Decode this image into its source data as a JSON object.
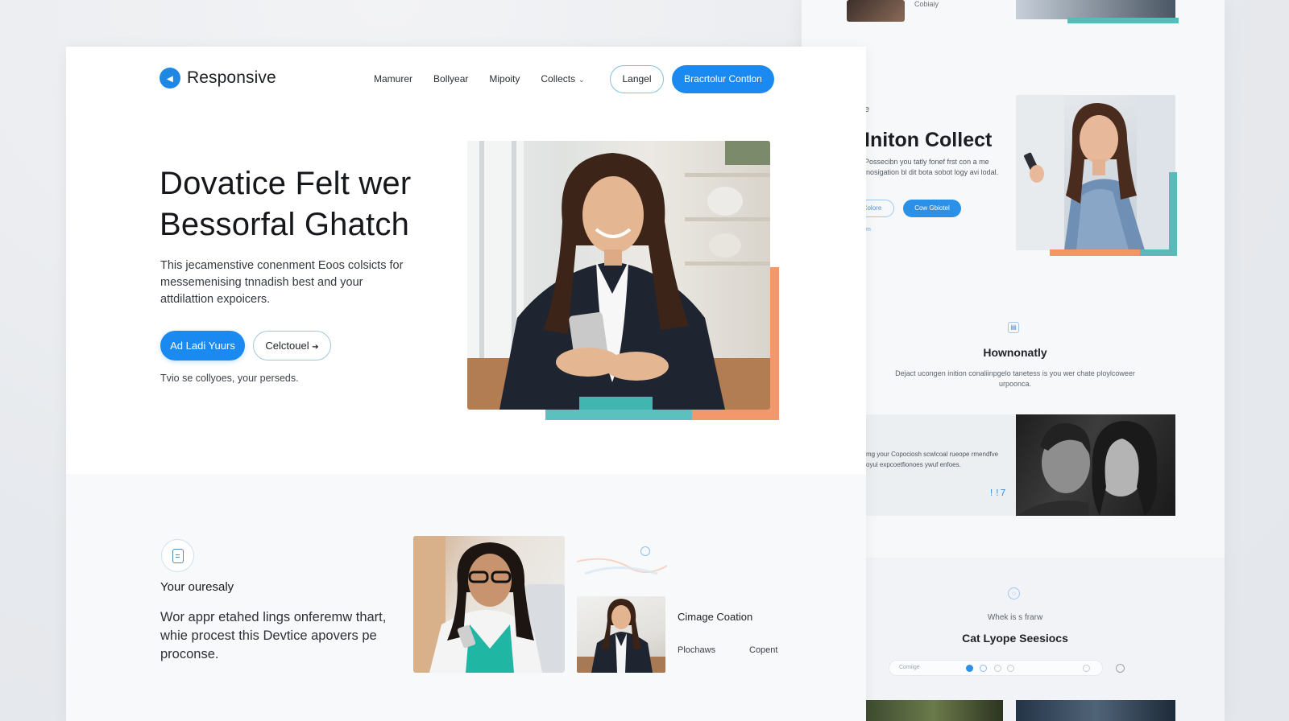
{
  "secondary_page": {
    "small_label_top": "Cobiaiy",
    "eyebrow": "e",
    "title": "Initon Collect",
    "description": "Possecibn you tatly fonef frst con a me inosigation bl dit bota sobot logy avi lodal.",
    "button_ghost": "Colore",
    "button_solid": "Cow Gbiotel",
    "tiny_link": "m",
    "feature_title": "Hownonatly",
    "feature_description": "Dejact ucongen inition conaliinpgelo tanetess is you wer chate ploylcoweer urpoonca.",
    "card_text": "mg your Copociosh scwlcoal rueope rmendfve oyui expcoetfionoes ywuf enfoes.",
    "card_number": "!!7",
    "panel_eyebrow": "Whek is s frarw",
    "panel_title": "Cat Lyope Seesiocs",
    "panel_bar_label": "Comiige"
  },
  "main_page": {
    "logo_text": "Responsive",
    "nav_links": [
      "Mamurer",
      "Bollyear",
      "Mipoity",
      "Collects"
    ],
    "nav_button_outline": "Langel",
    "nav_button_primary": "Bracrtolur Contlon",
    "hero": {
      "title": "Dovatice Felt wer Bessorfal Ghatch",
      "description": "This jecamenstive conenment Eoos colsicts for messemenising tnnadish best and your attdilattion expoicers.",
      "button_primary": "Ad Ladi Yuurs",
      "button_outline": "Celctouel",
      "note": "Tvio se collyoes, your perseds."
    },
    "section_two": {
      "heading": "Your ouresaly",
      "text": "Wor appr etahed lings onferemw thart, whie procest this Devtice apovers pe proconse.",
      "caption_title": "Cimage Coation",
      "caption_a": "Plochaws",
      "caption_b": "Copent"
    }
  },
  "colors": {
    "primary": "#1a8af0",
    "teal_accent": "#5cc0be",
    "orange_accent": "#f3976c"
  }
}
